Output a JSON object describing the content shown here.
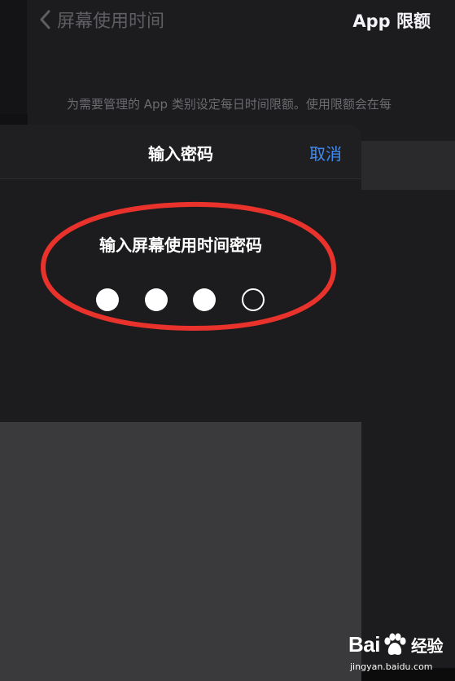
{
  "background": {
    "back_label": "屏幕使用时间",
    "title": "App 限额",
    "description": "为需要管理的 App 类别设定每日时间限额。使用限额会在每"
  },
  "sheet": {
    "title": "输入密码",
    "cancel_label": "取消",
    "prompt": "输入屏幕使用时间密码",
    "passcode": {
      "length": 4,
      "entered": 3
    }
  },
  "watermark": {
    "brand_left": "Bai",
    "brand_right": "经验",
    "url": "jingyan.baidu.com"
  },
  "colors": {
    "accent": "#3e8bf5",
    "annotation": "#e8322b",
    "sheet_bg": "#1c1c1e",
    "keypad_bg": "#3a3a3c"
  }
}
